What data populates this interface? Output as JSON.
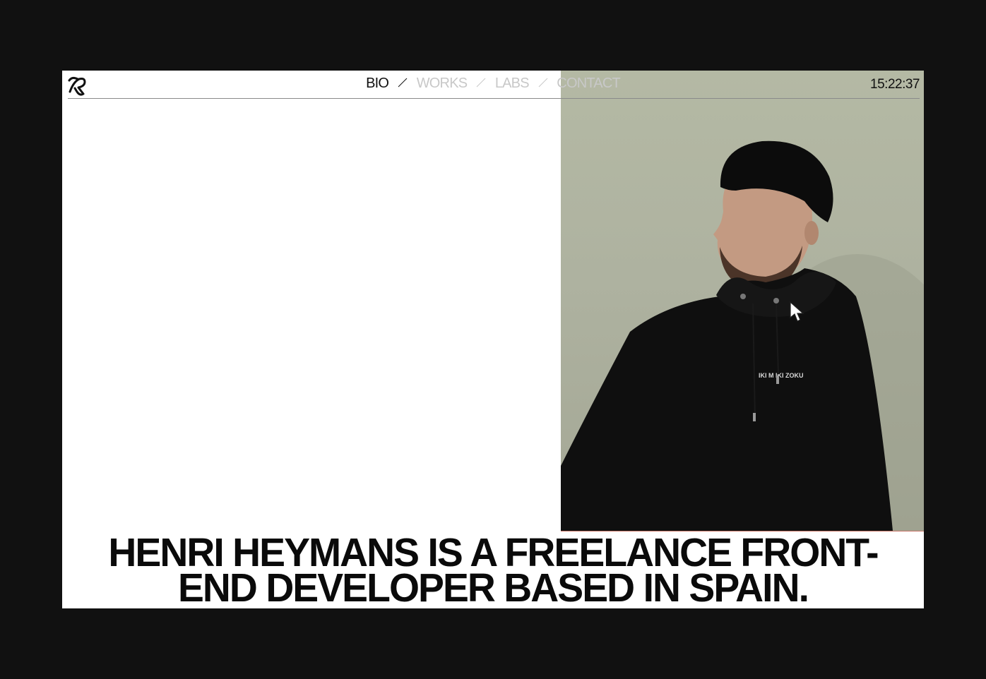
{
  "nav": {
    "items": [
      {
        "label": "BIO",
        "active": true
      },
      {
        "label": "WORKS",
        "active": false
      },
      {
        "label": "LABS",
        "active": false
      },
      {
        "label": "CONTACT",
        "active": false
      }
    ]
  },
  "header": {
    "logo_icon": "script-r-logo-icon",
    "clock": "15:22:37"
  },
  "hero": {
    "headline_line1": "HENRI HEYMANS IS A FREELANCE FRONT-",
    "headline_line2": "END DEVELOPER BASED IN SPAIN.",
    "photo_icon": "portrait-photo",
    "hoodie_text": "IKI M  IKI ZOKU"
  },
  "colors": {
    "background": "#111111",
    "page": "#ffffff",
    "text": "#111111",
    "nav_inactive": "#c8c8c8",
    "photo_backdrop": "#aeb2a0"
  }
}
